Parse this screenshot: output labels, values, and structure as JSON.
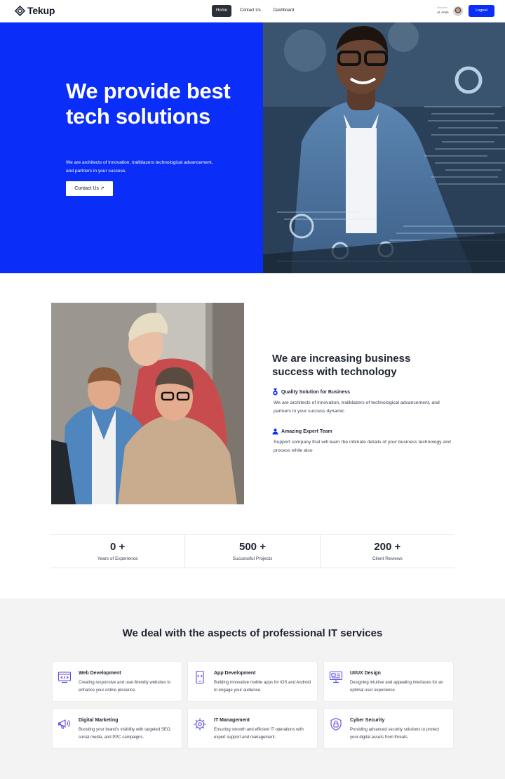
{
  "brand": {
    "name": "Tekup"
  },
  "nav": {
    "links": [
      "Home",
      "Contact Us",
      "Dashboard"
    ],
    "welcome": "Welcome",
    "user_name": "Al. Amin",
    "logout_label": "Logout"
  },
  "hero": {
    "title": "We provide best tech solutions",
    "subtitle": "We are architects of innovation, trailblazers technological advancement, and partners in your success.",
    "cta_label": "Contact Us ↗"
  },
  "about": {
    "title": "We are increasing business success with technology",
    "features": [
      {
        "title": "Quality Solution for Business",
        "text": "We are architects of innovation, trailblazers of technological advancement, and partners in your success dynamic",
        "icon": "medal-icon"
      },
      {
        "title": "Amazing Expert Team",
        "text": "Support company that will learn the intimate details of your business technology and process while also",
        "icon": "team-icon"
      }
    ]
  },
  "stats": [
    {
      "value": "0 +",
      "label": "Years of Experience"
    },
    {
      "value": "500 +",
      "label": "Successful Projects"
    },
    {
      "value": "200 +",
      "label": "Client Reviews"
    }
  ],
  "services": {
    "title": "We deal with the aspects of professional IT services",
    "items": [
      {
        "title": "Web Development",
        "desc": "Creating responsive and user-friendly websites to enhance your online presence.",
        "icon": "web-development-icon"
      },
      {
        "title": "App Development",
        "desc": "Building innovative mobile apps for iOS and Android to engage your audience.",
        "icon": "app-development-icon"
      },
      {
        "title": "UI/UX Design",
        "desc": "Designing intuitive and appealing interfaces for an optimal user experience.",
        "icon": "design-icon"
      },
      {
        "title": "Digital Marketing",
        "desc": "Boosting your brand's visibility with targeted SEO, social media, and PPC campaigns.",
        "icon": "marketing-icon"
      },
      {
        "title": "IT Management",
        "desc": "Ensuring smooth and efficient IT operations with expert support and management.",
        "icon": "it-management-icon"
      },
      {
        "title": "Cyber Security",
        "desc": "Providing advanced security solutions to protect your digital assets from threats.",
        "icon": "cyber-security-icon"
      }
    ]
  },
  "colors": {
    "accent": "#0a2df7",
    "dark": "#2b2f38",
    "section_bg": "#f3f3f3"
  }
}
